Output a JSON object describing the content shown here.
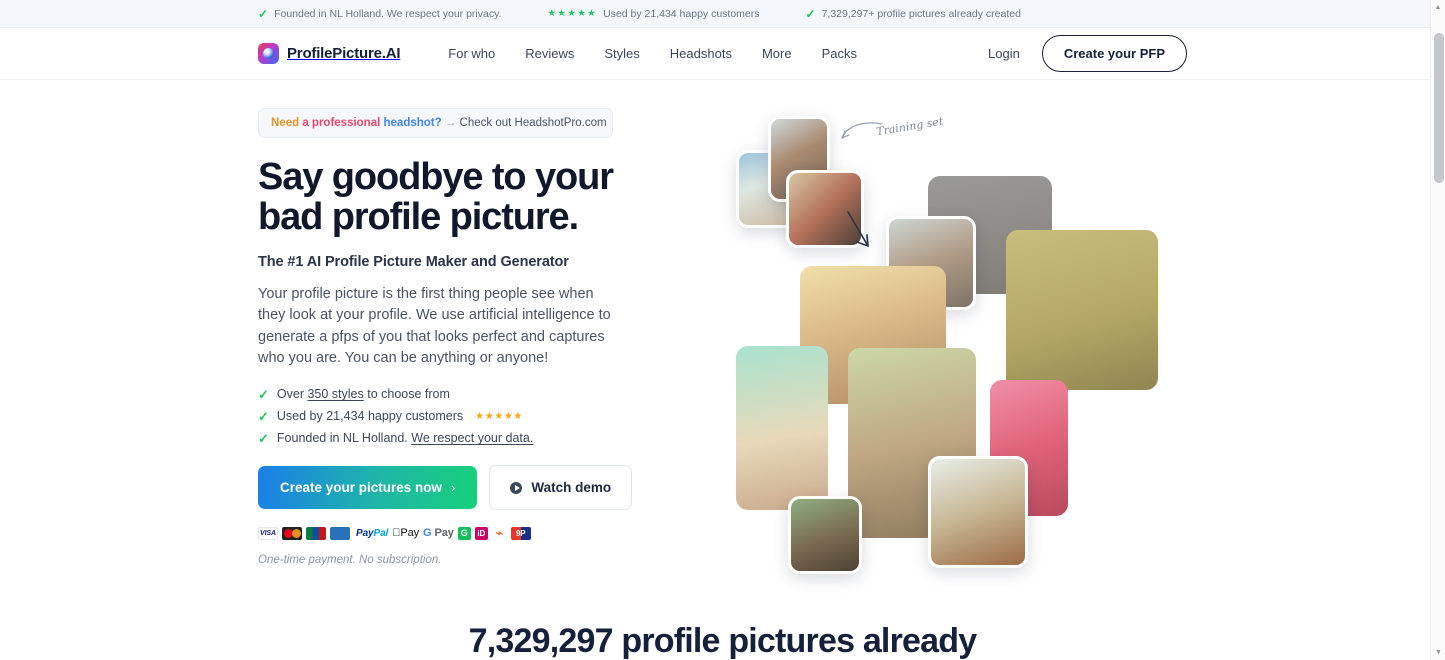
{
  "topbar": {
    "items": [
      {
        "icon": "check-icon",
        "text": "Founded in NL Holland. We respect your privacy."
      },
      {
        "icon": "stars-icon",
        "stars": "★★★★★",
        "text": "Used by 21,434 happy customers"
      },
      {
        "icon": "check-icon",
        "text": "7,329,297+ profile pictures already created"
      }
    ]
  },
  "nav": {
    "brand": "ProfilePicture.AI",
    "links": [
      {
        "label": "For who"
      },
      {
        "label": "Reviews"
      },
      {
        "label": "Styles"
      },
      {
        "label": "Headshots"
      },
      {
        "label": "More"
      },
      {
        "label": "Packs"
      }
    ],
    "login": "Login",
    "cta": "Create your PFP"
  },
  "promo": {
    "word1": "Need",
    "word2": "a professional",
    "word3": "headshot?",
    "dash": "→",
    "tail": "Check out HeadshotPro.com"
  },
  "hero": {
    "headline_line1": "Say goodbye to your",
    "headline_line2": "bad profile picture.",
    "subhead": "The #1 AI Profile Picture Maker and Generator",
    "body": "Your profile picture is the first thing people see when they look at your profile. We use artificial intelligence to generate a pfps of you that looks perfect and captures who you are. You can be anything or anyone!",
    "features": [
      {
        "pre": "Over ",
        "link": "350 styles",
        "post": " to choose from",
        "stars": ""
      },
      {
        "pre": "Used by 21,434 happy customers",
        "link": "",
        "post": "",
        "stars": "★★★★★"
      },
      {
        "pre": "Founded in NL Holland. ",
        "link": "We respect your data.",
        "post": "",
        "stars": ""
      }
    ],
    "cta_primary": "Create your pictures now",
    "cta_primary_chevron": "›",
    "cta_secondary": "Watch demo",
    "fineprint": "One-time payment. No subscription.",
    "payments": [
      {
        "name": "visa",
        "label": "VISA"
      },
      {
        "name": "mastercard",
        "label": ""
      },
      {
        "name": "jcb",
        "label": ""
      },
      {
        "name": "amex",
        "label": ""
      },
      {
        "name": "paypal",
        "label": "PayPal"
      },
      {
        "name": "apple-pay",
        "label": "Pay"
      },
      {
        "name": "google-pay",
        "label": "Pay"
      },
      {
        "name": "green-card",
        "label": "G"
      },
      {
        "name": "ideal",
        "label": "iD"
      },
      {
        "name": "sofort",
        "label": ""
      },
      {
        "name": "giropay",
        "label": "9P"
      }
    ],
    "annotation": "Training set"
  },
  "bottom": {
    "heading": "7,329,297 profile pictures already"
  },
  "colors": {
    "accent_blue": "#1a7fe8",
    "accent_green": "#16d07a",
    "check_green": "#22c55e",
    "star_gold": "#f5a623",
    "brand_dark": "#17203a"
  }
}
